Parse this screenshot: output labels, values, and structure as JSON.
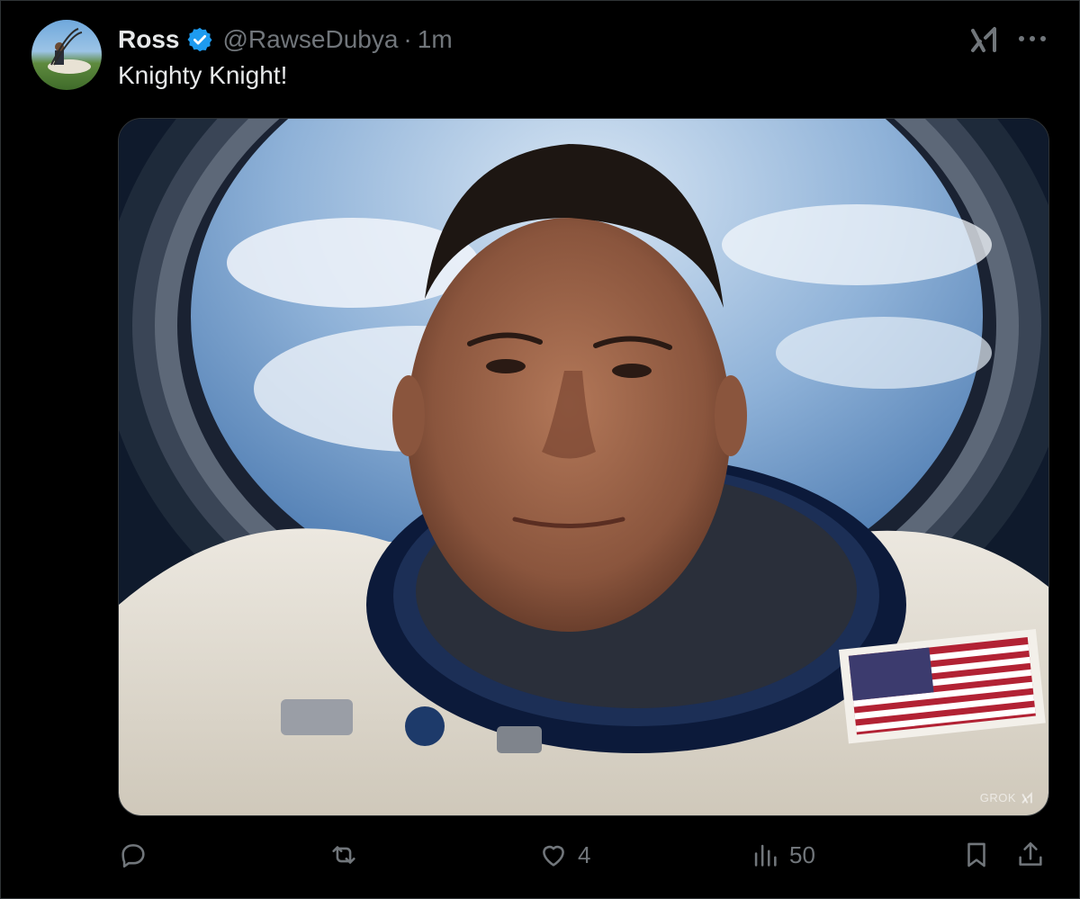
{
  "tweet": {
    "author_name": "Ross",
    "handle": "@RawseDubya",
    "separator": "·",
    "time": "1m",
    "text": "Knighty Knight!"
  },
  "media": {
    "watermark": "GROK"
  },
  "actions": {
    "like_count": "4",
    "view_count": "50"
  },
  "icons": {
    "verified": "verified-badge-icon",
    "grok": "grok-icon",
    "more": "more-icon",
    "reply": "reply-icon",
    "retweet": "retweet-icon",
    "like": "heart-icon",
    "views": "views-icon",
    "bookmark": "bookmark-icon",
    "share": "share-icon"
  },
  "colors": {
    "background": "#000000",
    "text": "#e7e9ea",
    "muted": "#71767b",
    "verified": "#1d9bf0"
  }
}
